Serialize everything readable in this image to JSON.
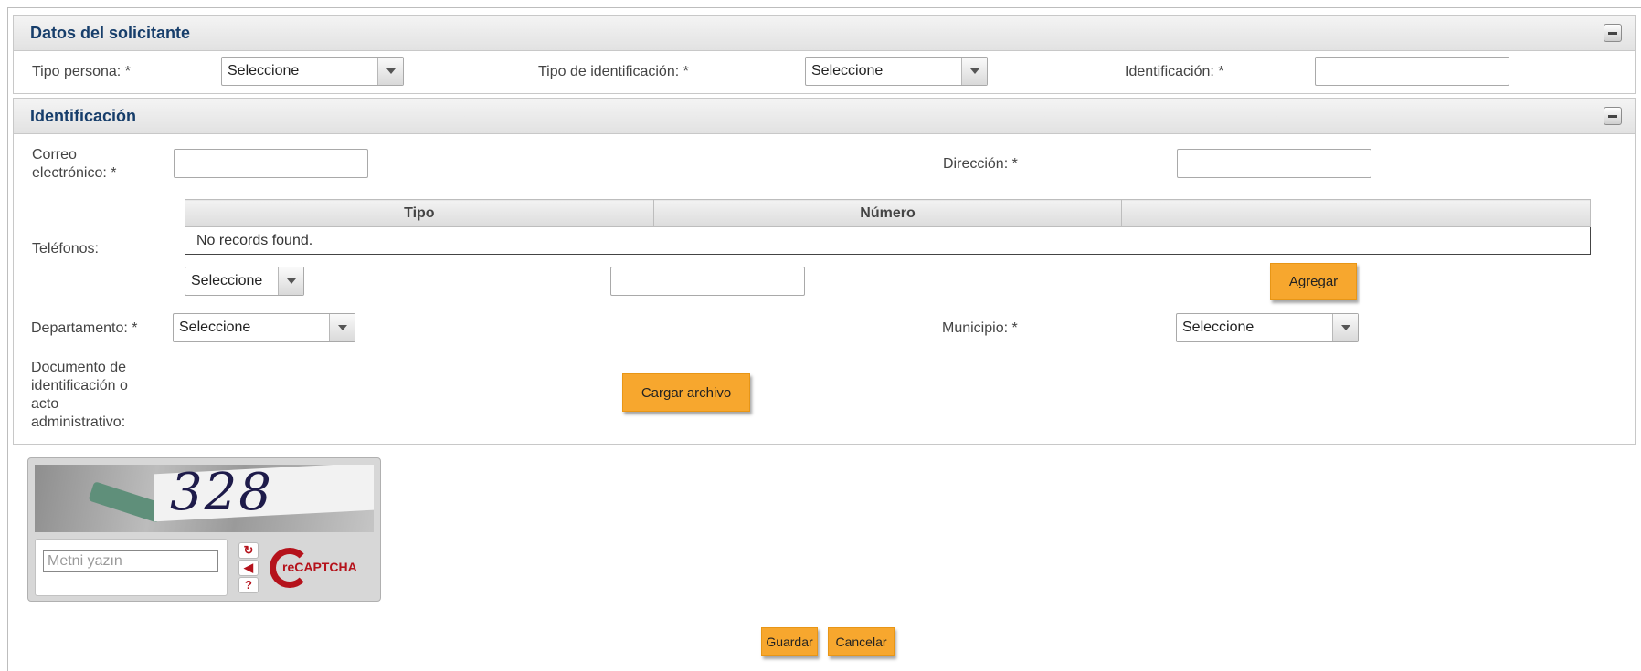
{
  "applicant": {
    "title": "Datos del solicitante",
    "person_type_label": "Tipo persona: *",
    "person_type_value": "Seleccione",
    "id_type_label": "Tipo de identificación: *",
    "id_type_value": "Seleccione",
    "id_label": "Identificación: *",
    "id_value": ""
  },
  "identification": {
    "title": "Identificación",
    "email_label_line1": "Correo",
    "email_label_line2": "electrónico: *",
    "email_value": "",
    "address_label": "Dirección: *",
    "address_value": "",
    "phones_label": "Teléfonos:",
    "phones_table": {
      "headers": [
        "Tipo",
        "Número",
        ""
      ],
      "empty_message": "No records found."
    },
    "phone_type_value": "Seleccione",
    "phone_number_value": "",
    "add_button": "Agregar",
    "department_label": "Departamento: *",
    "department_value": "Seleccione",
    "municipality_label": "Municipio: *",
    "municipality_value": "Seleccione",
    "document_label_lines": [
      "Documento de",
      "identificación o",
      "acto",
      "administrativo:"
    ],
    "upload_button": "Cargar archivo"
  },
  "captcha": {
    "image_text": "328",
    "placeholder": "Metni yazın",
    "logo_text": "reCAPTCHA",
    "tool_icons": [
      "refresh-icon",
      "audio-icon",
      "help-icon"
    ]
  },
  "actions": {
    "save": "Guardar",
    "cancel": "Cancelar"
  },
  "colors": {
    "button": "#f7a72e",
    "header_text": "#173e6b",
    "recaptcha_red": "#b5121b"
  }
}
